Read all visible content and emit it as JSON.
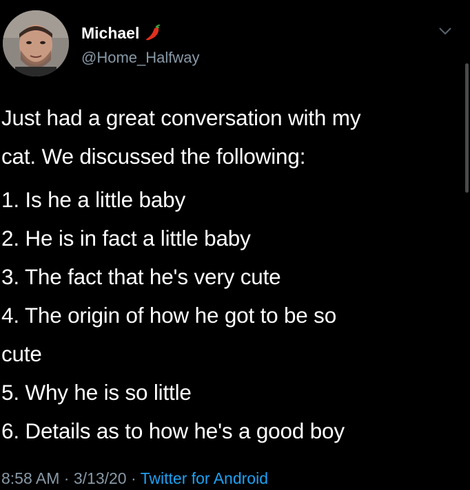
{
  "author": {
    "display_name": "Michael",
    "handle": "@Home_Halfway",
    "name_emoji_icon": "hot-pepper-icon"
  },
  "tweet": {
    "intro_lines": [
      "Just had a great conversation with my",
      "cat. We discussed the following:"
    ],
    "list_lines": [
      "1. Is he a little baby",
      "2. He is in fact a little baby",
      "3. The fact that he's very cute",
      "4. The origin of how he got to be so",
      "cute",
      "5. Why he is so little",
      "6. Details as to how he's a good boy"
    ]
  },
  "meta": {
    "time": "8:58 AM",
    "separator": " · ",
    "date": "3/13/20",
    "source": "Twitter for Android"
  },
  "colors": {
    "background": "#000000",
    "text": "#ffffff",
    "secondary": "#8899a6",
    "link": "#1da1f2"
  }
}
